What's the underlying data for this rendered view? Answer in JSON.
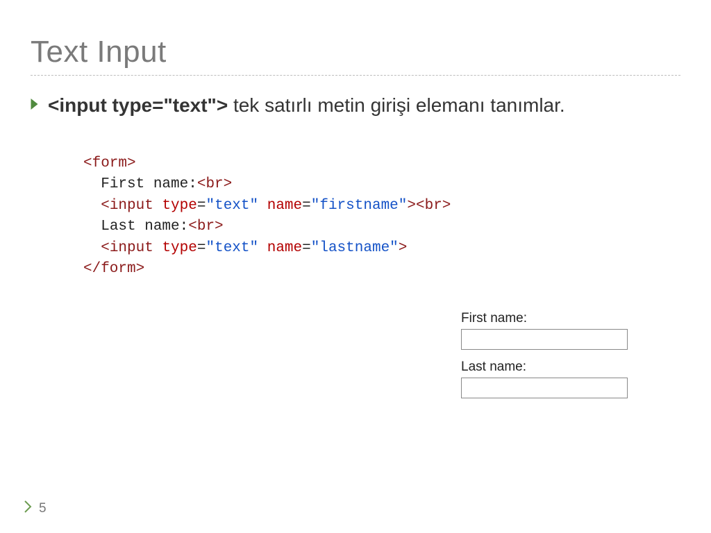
{
  "title": "Text Input",
  "bullet": {
    "code": "<input type=\"text\">",
    "rest": " tek satırlı metin girişi elemanı tanımlar."
  },
  "code": {
    "l1_open": "<form>",
    "l2_text": "First name:",
    "l2_br": "<br>",
    "l3_open": "<input",
    "l3_attr1_name": "type",
    "l3_attr1_val": "\"text\"",
    "l3_attr2_name": "name",
    "l3_attr2_val": "\"firstname\"",
    "l3_close": ">",
    "l3_br": "<br>",
    "l4_text": "Last name:",
    "l4_br": "<br>",
    "l5_open": "<input",
    "l5_attr1_name": "type",
    "l5_attr1_val": "\"text\"",
    "l5_attr2_name": "name",
    "l5_attr2_val": "\"lastname\"",
    "l5_close": ">",
    "l6_close": "</form>"
  },
  "form": {
    "firstLabel": "First name:",
    "lastLabel": "Last name:"
  },
  "page": "5"
}
